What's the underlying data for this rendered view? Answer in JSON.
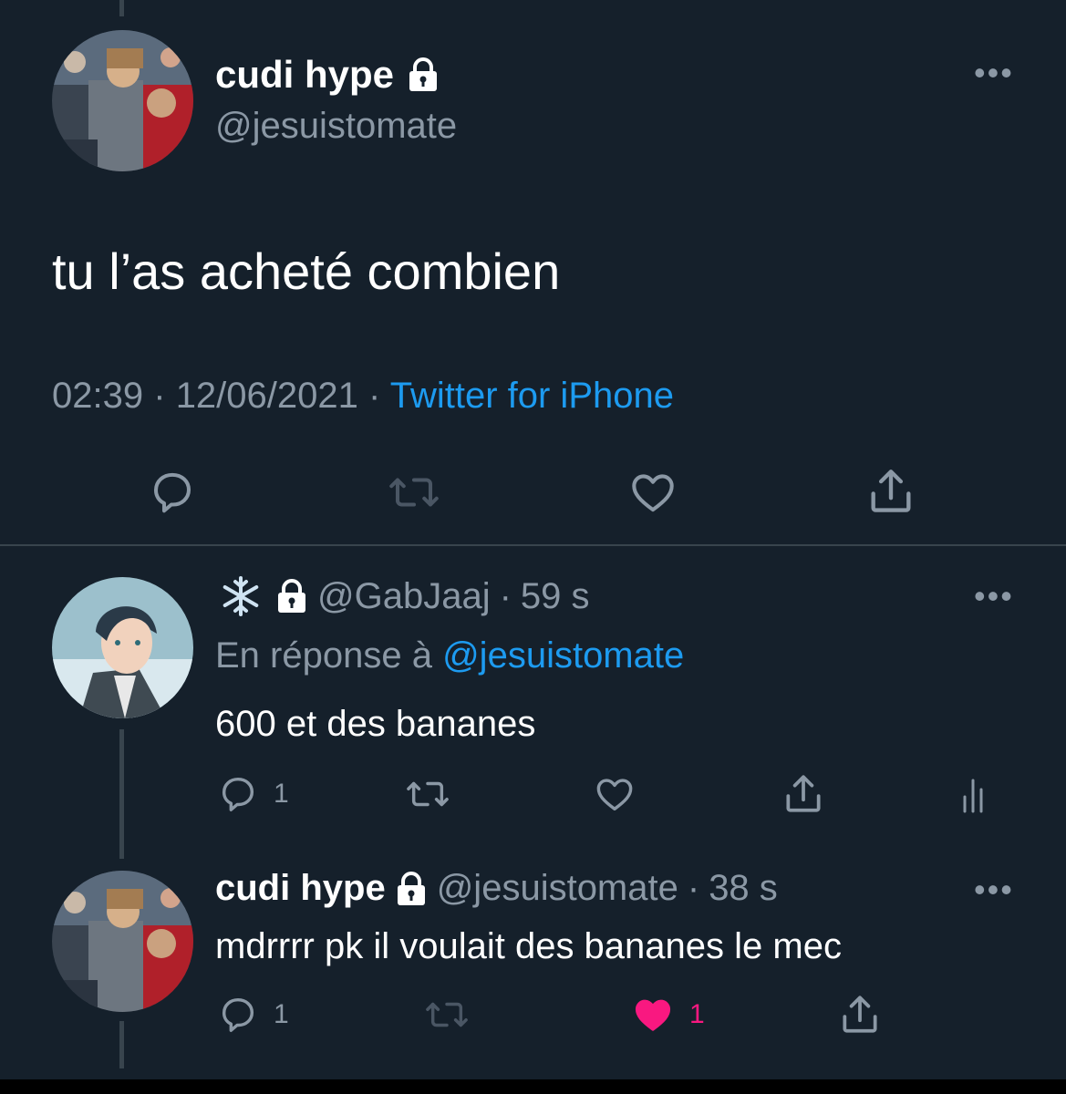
{
  "main_tweet": {
    "display_name": "cudi hype",
    "handle": "@jesuistomate",
    "text": "tu l’as acheté combien",
    "time": "02:39",
    "date": "12/06/2021",
    "source": "Twitter for iPhone",
    "sep": "·",
    "actions": [
      {
        "icon": "reply-icon"
      },
      {
        "icon": "retweet-icon"
      },
      {
        "icon": "like-icon"
      },
      {
        "icon": "share-icon"
      }
    ]
  },
  "replies": [
    {
      "display_name": "❄️",
      "handle": "@GabJaaj",
      "sep": "·",
      "time": "59 s",
      "reply_prefix": "En réponse à",
      "reply_mention": "@jesuistomate",
      "text": "600 et des bananes",
      "reply_count": "1",
      "like_count": "",
      "liked": false
    },
    {
      "display_name": "cudi hype",
      "handle": "@jesuistomate",
      "sep": "·",
      "time": "38 s",
      "text": "mdrrrr pk il voulait des bananes le mec",
      "reply_count": "1",
      "like_count": "1",
      "liked": true
    }
  ],
  "colors": {
    "background": "#15202b",
    "text_primary": "#ffffff",
    "text_secondary": "#8b98a5",
    "accent_blue": "#1d9bf0",
    "like_pink": "#f91880",
    "divider": "#38444d"
  },
  "icons": {
    "lock": "lock-icon",
    "more": "more-icon",
    "snowflake": "snowflake-icon",
    "analytics": "analytics-icon"
  }
}
